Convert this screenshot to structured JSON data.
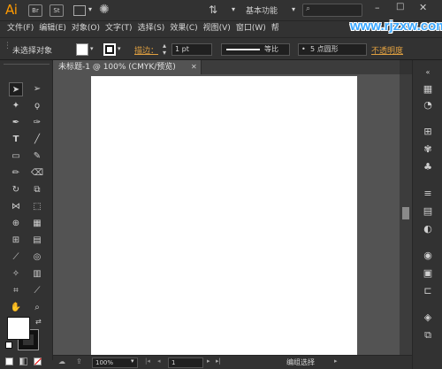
{
  "app": {
    "logo": "Ai"
  },
  "titlebar": {
    "br_label": "Br",
    "st_label": "St",
    "workspace": "基本功能",
    "watermark": "www.rjzxw.com"
  },
  "menu": [
    "文件(F)",
    "编辑(E)",
    "对象(O)",
    "文字(T)",
    "选择(S)",
    "效果(C)",
    "视图(V)",
    "窗口(W)",
    "帮"
  ],
  "control": {
    "selection_label": "未选择对象",
    "stroke_label": "描边：",
    "stroke_weight": "1 pt",
    "stroke_style": "等比",
    "brush": "5 点圆形",
    "opacity_label": "不透明度"
  },
  "document": {
    "tab_title": "未标题-1 @ 100% (CMYK/预览)"
  },
  "statusbar": {
    "zoom": "100%",
    "page": "1",
    "status": "编组选择"
  },
  "colors": {
    "accent": "#ff9a00",
    "watermark": "#3aa7ff",
    "stroke_label": "#e0a040"
  }
}
